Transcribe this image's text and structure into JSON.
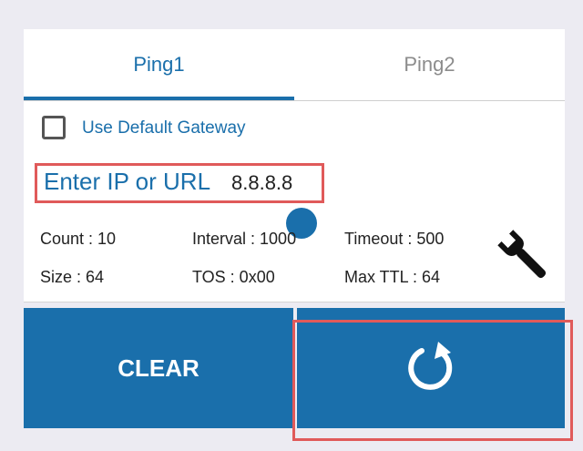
{
  "tabs": [
    {
      "label": "Ping1",
      "active": true
    },
    {
      "label": "Ping2",
      "active": false
    }
  ],
  "gateway": {
    "label": "Use Default Gateway",
    "checked": false
  },
  "target": {
    "label": "Enter IP or URL",
    "value": "8.8.8.8"
  },
  "params": {
    "count": "Count : 10",
    "interval": "Interval : 1000",
    "timeout": "Timeout : 500",
    "size": "Size : 64",
    "tos": "TOS : 0x00",
    "max_ttl": "Max TTL : 64"
  },
  "icons": {
    "settings": "wrench-icon",
    "start": "refresh-icon"
  },
  "buttons": {
    "clear": "CLEAR"
  },
  "colors": {
    "accent": "#1a6fab",
    "highlight": "#e05a5a",
    "inactive_tab": "#8c8c8c"
  }
}
